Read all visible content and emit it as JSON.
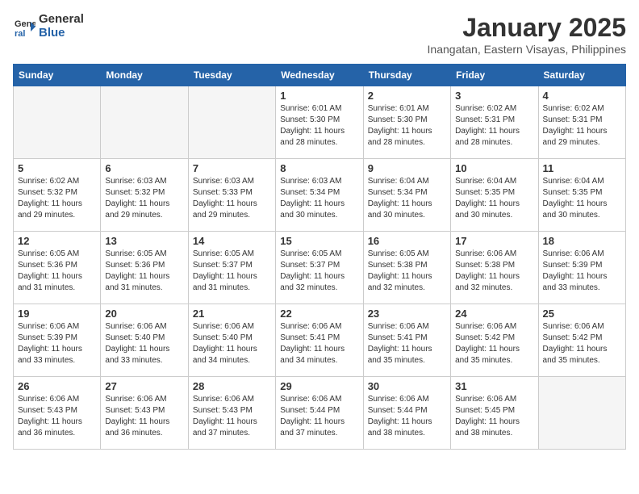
{
  "header": {
    "logo_line1": "General",
    "logo_line2": "Blue",
    "month": "January 2025",
    "location": "Inangatan, Eastern Visayas, Philippines"
  },
  "weekdays": [
    "Sunday",
    "Monday",
    "Tuesday",
    "Wednesday",
    "Thursday",
    "Friday",
    "Saturday"
  ],
  "weeks": [
    [
      {
        "day": "",
        "info": ""
      },
      {
        "day": "",
        "info": ""
      },
      {
        "day": "",
        "info": ""
      },
      {
        "day": "1",
        "info": "Sunrise: 6:01 AM\nSunset: 5:30 PM\nDaylight: 11 hours\nand 28 minutes."
      },
      {
        "day": "2",
        "info": "Sunrise: 6:01 AM\nSunset: 5:30 PM\nDaylight: 11 hours\nand 28 minutes."
      },
      {
        "day": "3",
        "info": "Sunrise: 6:02 AM\nSunset: 5:31 PM\nDaylight: 11 hours\nand 28 minutes."
      },
      {
        "day": "4",
        "info": "Sunrise: 6:02 AM\nSunset: 5:31 PM\nDaylight: 11 hours\nand 29 minutes."
      }
    ],
    [
      {
        "day": "5",
        "info": "Sunrise: 6:02 AM\nSunset: 5:32 PM\nDaylight: 11 hours\nand 29 minutes."
      },
      {
        "day": "6",
        "info": "Sunrise: 6:03 AM\nSunset: 5:32 PM\nDaylight: 11 hours\nand 29 minutes."
      },
      {
        "day": "7",
        "info": "Sunrise: 6:03 AM\nSunset: 5:33 PM\nDaylight: 11 hours\nand 29 minutes."
      },
      {
        "day": "8",
        "info": "Sunrise: 6:03 AM\nSunset: 5:34 PM\nDaylight: 11 hours\nand 30 minutes."
      },
      {
        "day": "9",
        "info": "Sunrise: 6:04 AM\nSunset: 5:34 PM\nDaylight: 11 hours\nand 30 minutes."
      },
      {
        "day": "10",
        "info": "Sunrise: 6:04 AM\nSunset: 5:35 PM\nDaylight: 11 hours\nand 30 minutes."
      },
      {
        "day": "11",
        "info": "Sunrise: 6:04 AM\nSunset: 5:35 PM\nDaylight: 11 hours\nand 30 minutes."
      }
    ],
    [
      {
        "day": "12",
        "info": "Sunrise: 6:05 AM\nSunset: 5:36 PM\nDaylight: 11 hours\nand 31 minutes."
      },
      {
        "day": "13",
        "info": "Sunrise: 6:05 AM\nSunset: 5:36 PM\nDaylight: 11 hours\nand 31 minutes."
      },
      {
        "day": "14",
        "info": "Sunrise: 6:05 AM\nSunset: 5:37 PM\nDaylight: 11 hours\nand 31 minutes."
      },
      {
        "day": "15",
        "info": "Sunrise: 6:05 AM\nSunset: 5:37 PM\nDaylight: 11 hours\nand 32 minutes."
      },
      {
        "day": "16",
        "info": "Sunrise: 6:05 AM\nSunset: 5:38 PM\nDaylight: 11 hours\nand 32 minutes."
      },
      {
        "day": "17",
        "info": "Sunrise: 6:06 AM\nSunset: 5:38 PM\nDaylight: 11 hours\nand 32 minutes."
      },
      {
        "day": "18",
        "info": "Sunrise: 6:06 AM\nSunset: 5:39 PM\nDaylight: 11 hours\nand 33 minutes."
      }
    ],
    [
      {
        "day": "19",
        "info": "Sunrise: 6:06 AM\nSunset: 5:39 PM\nDaylight: 11 hours\nand 33 minutes."
      },
      {
        "day": "20",
        "info": "Sunrise: 6:06 AM\nSunset: 5:40 PM\nDaylight: 11 hours\nand 33 minutes."
      },
      {
        "day": "21",
        "info": "Sunrise: 6:06 AM\nSunset: 5:40 PM\nDaylight: 11 hours\nand 34 minutes."
      },
      {
        "day": "22",
        "info": "Sunrise: 6:06 AM\nSunset: 5:41 PM\nDaylight: 11 hours\nand 34 minutes."
      },
      {
        "day": "23",
        "info": "Sunrise: 6:06 AM\nSunset: 5:41 PM\nDaylight: 11 hours\nand 35 minutes."
      },
      {
        "day": "24",
        "info": "Sunrise: 6:06 AM\nSunset: 5:42 PM\nDaylight: 11 hours\nand 35 minutes."
      },
      {
        "day": "25",
        "info": "Sunrise: 6:06 AM\nSunset: 5:42 PM\nDaylight: 11 hours\nand 35 minutes."
      }
    ],
    [
      {
        "day": "26",
        "info": "Sunrise: 6:06 AM\nSunset: 5:43 PM\nDaylight: 11 hours\nand 36 minutes."
      },
      {
        "day": "27",
        "info": "Sunrise: 6:06 AM\nSunset: 5:43 PM\nDaylight: 11 hours\nand 36 minutes."
      },
      {
        "day": "28",
        "info": "Sunrise: 6:06 AM\nSunset: 5:43 PM\nDaylight: 11 hours\nand 37 minutes."
      },
      {
        "day": "29",
        "info": "Sunrise: 6:06 AM\nSunset: 5:44 PM\nDaylight: 11 hours\nand 37 minutes."
      },
      {
        "day": "30",
        "info": "Sunrise: 6:06 AM\nSunset: 5:44 PM\nDaylight: 11 hours\nand 38 minutes."
      },
      {
        "day": "31",
        "info": "Sunrise: 6:06 AM\nSunset: 5:45 PM\nDaylight: 11 hours\nand 38 minutes."
      },
      {
        "day": "",
        "info": ""
      }
    ]
  ]
}
